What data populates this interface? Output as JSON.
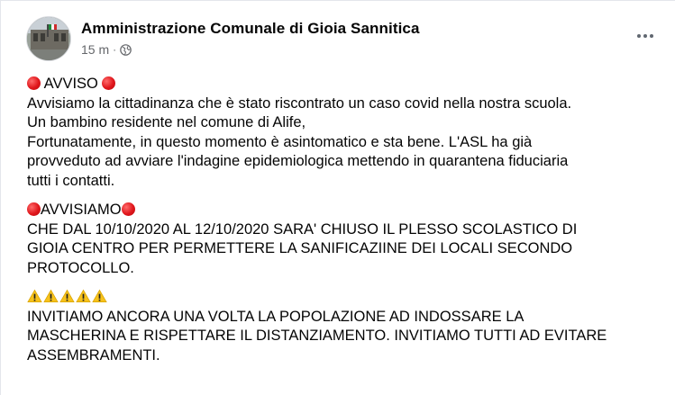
{
  "post": {
    "author": "Amministrazione Comunale di Gioia Sannitica",
    "time": "15 m",
    "separator": "·",
    "visibility_icon": "globe-icon",
    "more_icon": "more-options-icon",
    "paragraphs": [
      {
        "lines": [
          {
            "prefix_icon": "red-circle-icon",
            "text": " AVVISO ",
            "suffix_icon": "red-circle-icon"
          },
          {
            "text": "Avvisiamo la cittadinanza che è stato riscontrato un caso covid nella nostra scuola."
          },
          {
            "text": "Un bambino residente nel comune di Alife,"
          },
          {
            "text": "Fortunatamente, in questo momento è asintomatico e sta bene. L'ASL ha già"
          },
          {
            "text": "provveduto ad avviare l'indagine epidemiologica mettendo in quarantena fiduciaria"
          },
          {
            "text": "tutti i contatti."
          }
        ]
      },
      {
        "lines": [
          {
            "prefix_icon": "red-circle-icon",
            "text": "AVVISIAMO",
            "suffix_icon": "red-circle-icon"
          },
          {
            "text": "CHE DAL 10/10/2020 AL 12/10/2020 SARA' CHIUSO IL PLESSO SCOLASTICO  DI"
          },
          {
            "text": "GIOIA CENTRO PER PERMETTERE LA SANIFICAZIINE DEI LOCALI SECONDO"
          },
          {
            "text": "PROTOCOLLO."
          }
        ]
      },
      {
        "lines": [
          {
            "warning_icons": 5
          },
          {
            "text": "INVITIAMO ANCORA UNA VOLTA LA POPOLAZIONE AD INDOSSARE LA"
          },
          {
            "text": "MASCHERINA E RISPETTARE IL DISTANZIAMENTO. INVITIAMO TUTTI AD EVITARE"
          },
          {
            "text": "ASSEMBRAMENTI."
          }
        ]
      }
    ]
  },
  "colors": {
    "text": "#050505",
    "secondary_text": "#65676b",
    "red_emoji": "#e0161b",
    "warning_emoji": "#f7c21b"
  }
}
